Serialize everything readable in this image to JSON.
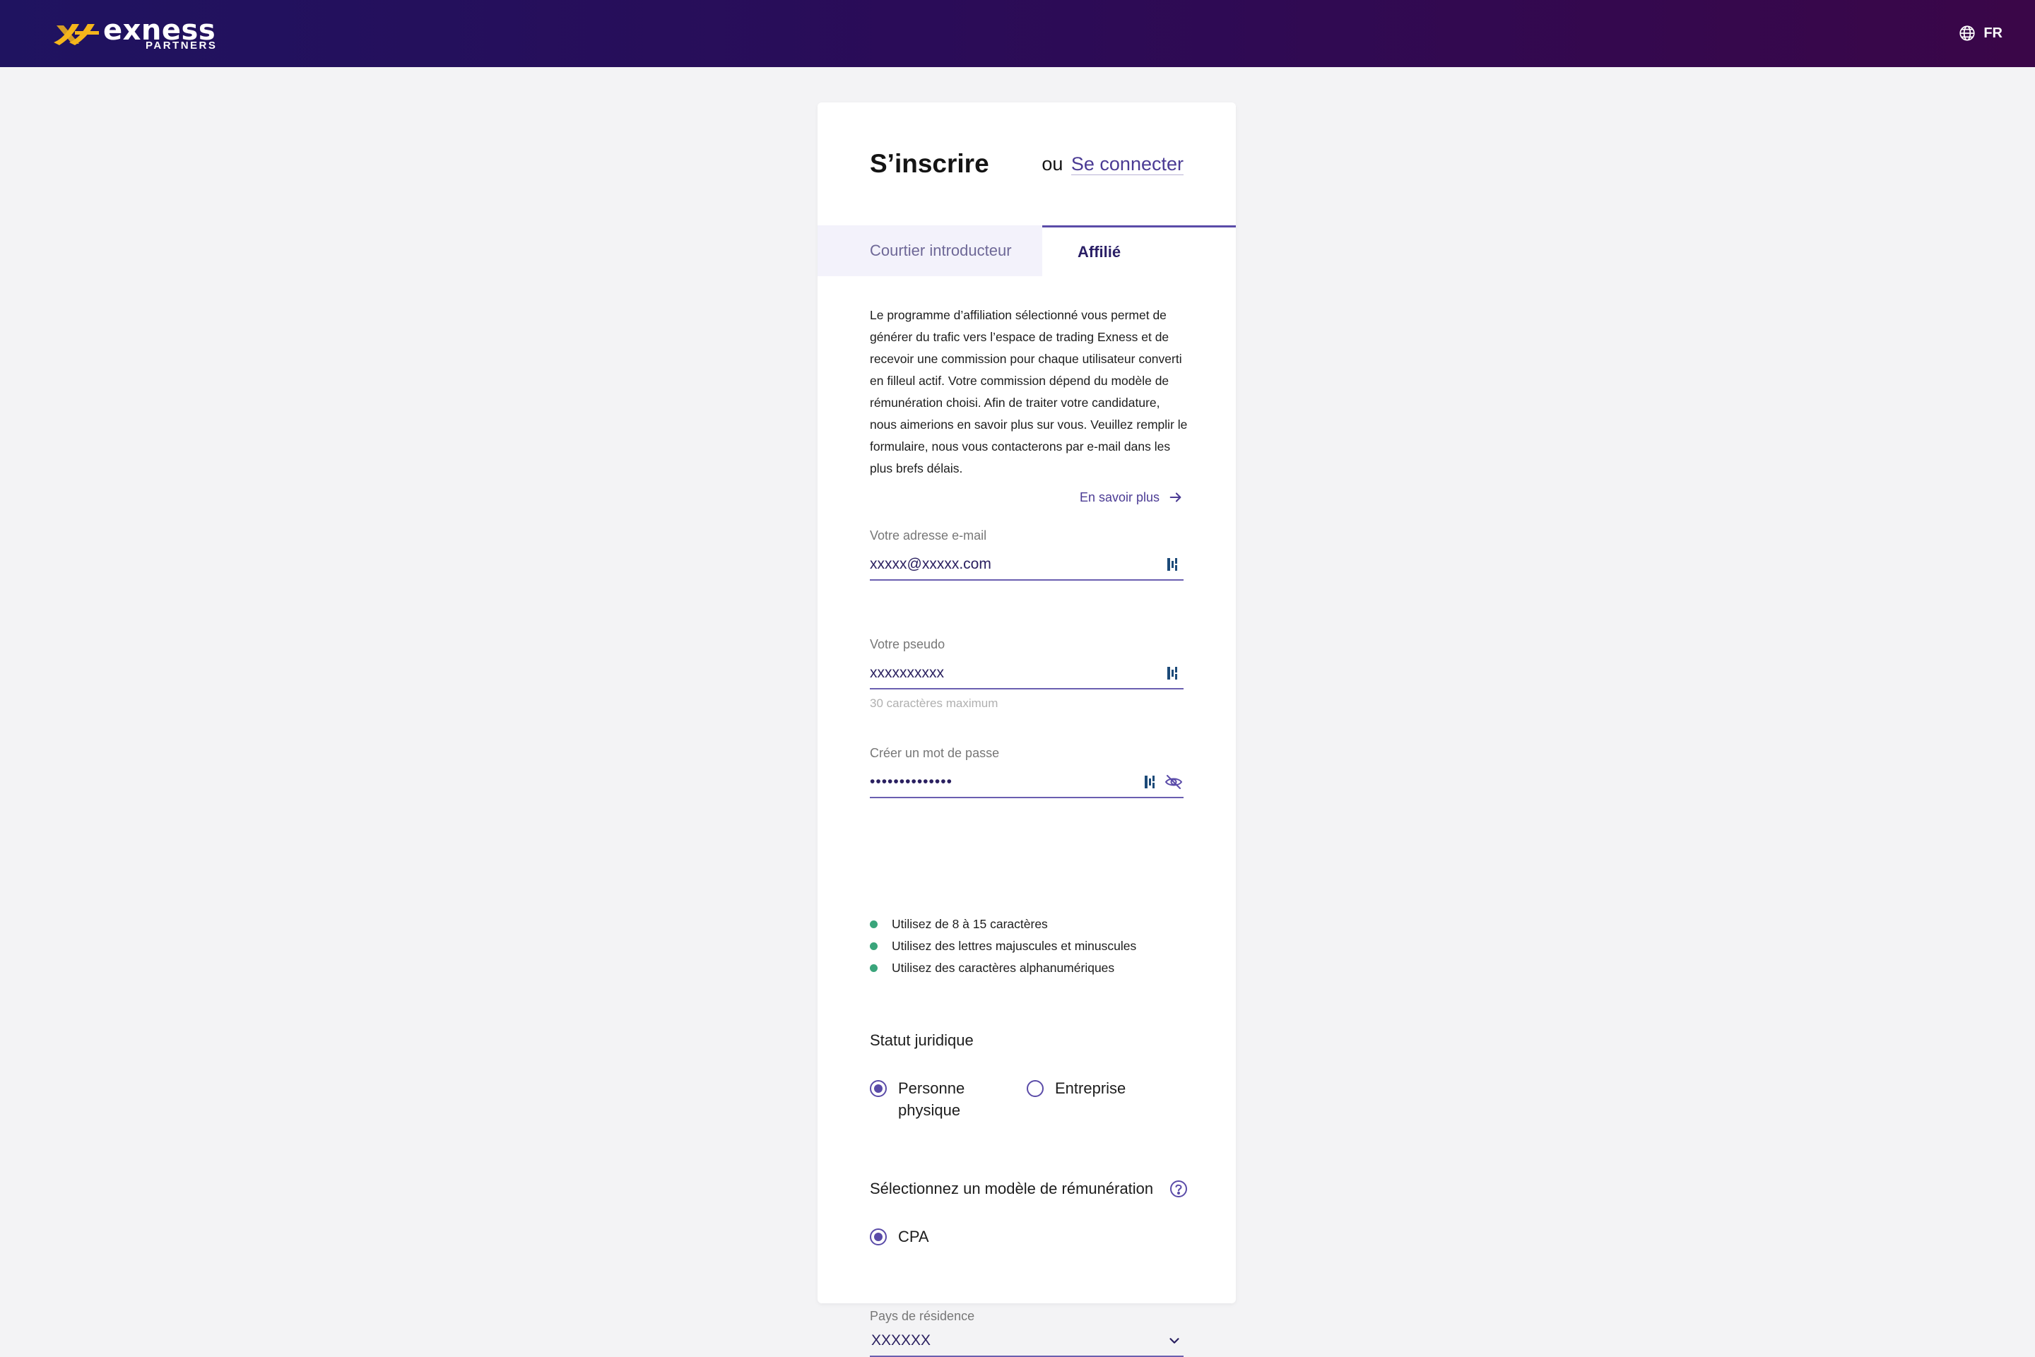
{
  "header": {
    "logo_word": "exness",
    "logo_sub": "PARTNERS",
    "language": "FR",
    "brand_color": "#f5b51b"
  },
  "card": {
    "title": "S’inscrire",
    "or_text": "ou",
    "login_link": "Se connecter"
  },
  "tabs": [
    {
      "label": "Courtier introducteur",
      "active": false
    },
    {
      "label": "Affilié",
      "active": true
    }
  ],
  "description": "Le programme d’affiliation sélectionné vous permet de générer du trafic vers l’espace de trading Exness et de recevoir une commission pour chaque utilisateur converti en filleul actif. Votre commission dépend du modèle de rémunération choisi. Afin de traiter votre candidature, nous aimerions en savoir plus sur vous. Veuillez remplir le formulaire, nous vous contacterons par e-mail dans les plus brefs délais.",
  "learn_more": "En savoir plus",
  "email": {
    "label": "Votre adresse e-mail",
    "value": "xxxxx@xxxxx.com"
  },
  "nickname": {
    "label": "Votre pseudo",
    "value": "xxxxxxxxxx",
    "hint": "30 caractères maximum"
  },
  "password": {
    "label": "Créer un mot de passe",
    "value": "••••••••••••••"
  },
  "password_rules": [
    "Utilisez de 8 à 15 caractères",
    "Utilisez des lettres majuscules et minuscules",
    "Utilisez des caractères alphanumériques"
  ],
  "legal_status": {
    "title": "Statut juridique",
    "options": [
      {
        "label_line1": "Personne",
        "label_line2": "physique",
        "selected": true
      },
      {
        "label": "Entreprise",
        "selected": false
      }
    ]
  },
  "remuneration": {
    "title": "Sélectionnez un modèle de rémunération",
    "option": "CPA",
    "selected": true
  },
  "country": {
    "label": "Pays de résidence",
    "value": "XXXXXX"
  }
}
